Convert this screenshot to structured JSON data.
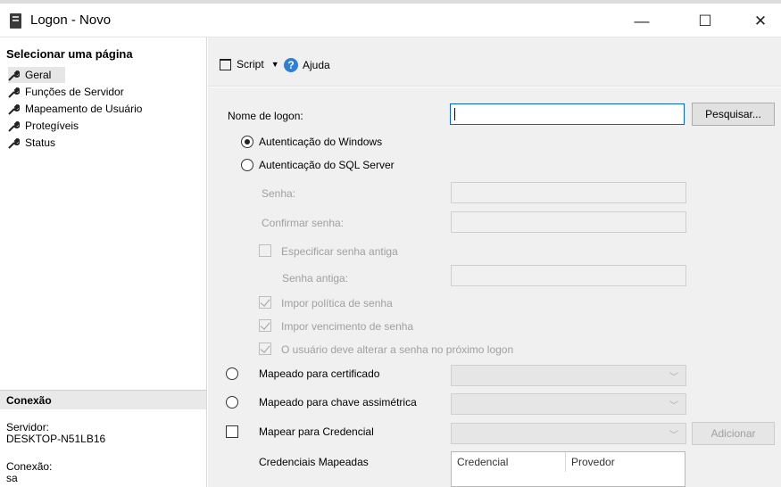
{
  "window": {
    "title": "Logon - Novo",
    "minimize": "—",
    "maximize": "☐",
    "close": "✕"
  },
  "sidebar": {
    "header": "Selecionar uma página",
    "items": [
      {
        "label": "Geral"
      },
      {
        "label": "Funções de Servidor"
      },
      {
        "label": "Mapeamento de Usuário"
      },
      {
        "label": "Protegíveis"
      },
      {
        "label": "Status"
      }
    ],
    "connection": {
      "header": "Conexão",
      "server_label": "Servidor:",
      "server_value": "DESKTOP-N51LB16",
      "connection_label": "Conexão:",
      "connection_value": "sa"
    }
  },
  "toolbar": {
    "script_label": "Script",
    "help_label": "Ajuda"
  },
  "form": {
    "login_name_label": "Nome de logon:",
    "login_name_value": "",
    "search_button": "Pesquisar...",
    "windows_auth": "Autenticação do Windows",
    "sql_auth": "Autenticação do SQL Server",
    "password_label": "Senha:",
    "confirm_password_label": "Confirmar senha:",
    "specify_old_password": "Especificar senha antiga",
    "old_password_label": "Senha antiga:",
    "enforce_policy": "Impor política de senha",
    "enforce_expiration": "Impor vencimento de senha",
    "must_change": "O usuário deve alterar a senha no próximo logon",
    "mapped_certificate": "Mapeado para certificado",
    "mapped_asymmetric_key": "Mapeado para chave assimétrica",
    "map_credential": "Mapear para Credencial",
    "add_button": "Adicionar",
    "mapped_credentials_label": "Credenciais Mapeadas",
    "credentials_table": {
      "columns": [
        "Credencial",
        "Provedor"
      ]
    }
  },
  "icons": {
    "app": "server-window-icon",
    "nav": "wrench-icon",
    "script": "script-icon",
    "help": "help-icon"
  }
}
